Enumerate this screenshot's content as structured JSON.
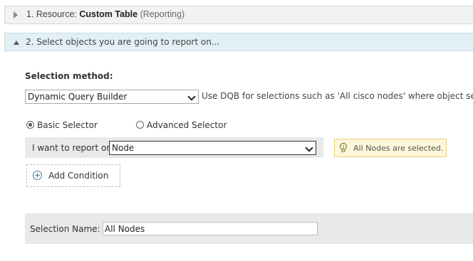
{
  "sections": {
    "resource": {
      "prefix": "1. Resource:",
      "name": "Custom Table",
      "category": "(Reporting)"
    },
    "select_objects": {
      "title": "2. Select objects you are going to report on..."
    }
  },
  "selection_method": {
    "label": "Selection method:",
    "value": "Dynamic Query Builder",
    "hint": "Use DQB for selections such as 'All cisco nodes' where object se"
  },
  "selector_modes": {
    "basic": {
      "label": "Basic Selector",
      "selected": true
    },
    "advanced": {
      "label": "Advanced Selector",
      "selected": false
    }
  },
  "report_on": {
    "label": "I want to report on",
    "value": "Node"
  },
  "info": {
    "text": "All Nodes are selected.",
    "icon": "lightbulb-icon"
  },
  "add_condition": {
    "label": "Add Condition"
  },
  "selection_name": {
    "label": "Selection Name:",
    "value": "All Nodes"
  },
  "colors": {
    "section_active_bg": "#e2f0f6",
    "info_bg": "#fdf7d9",
    "accent": "#4a7fa5"
  }
}
